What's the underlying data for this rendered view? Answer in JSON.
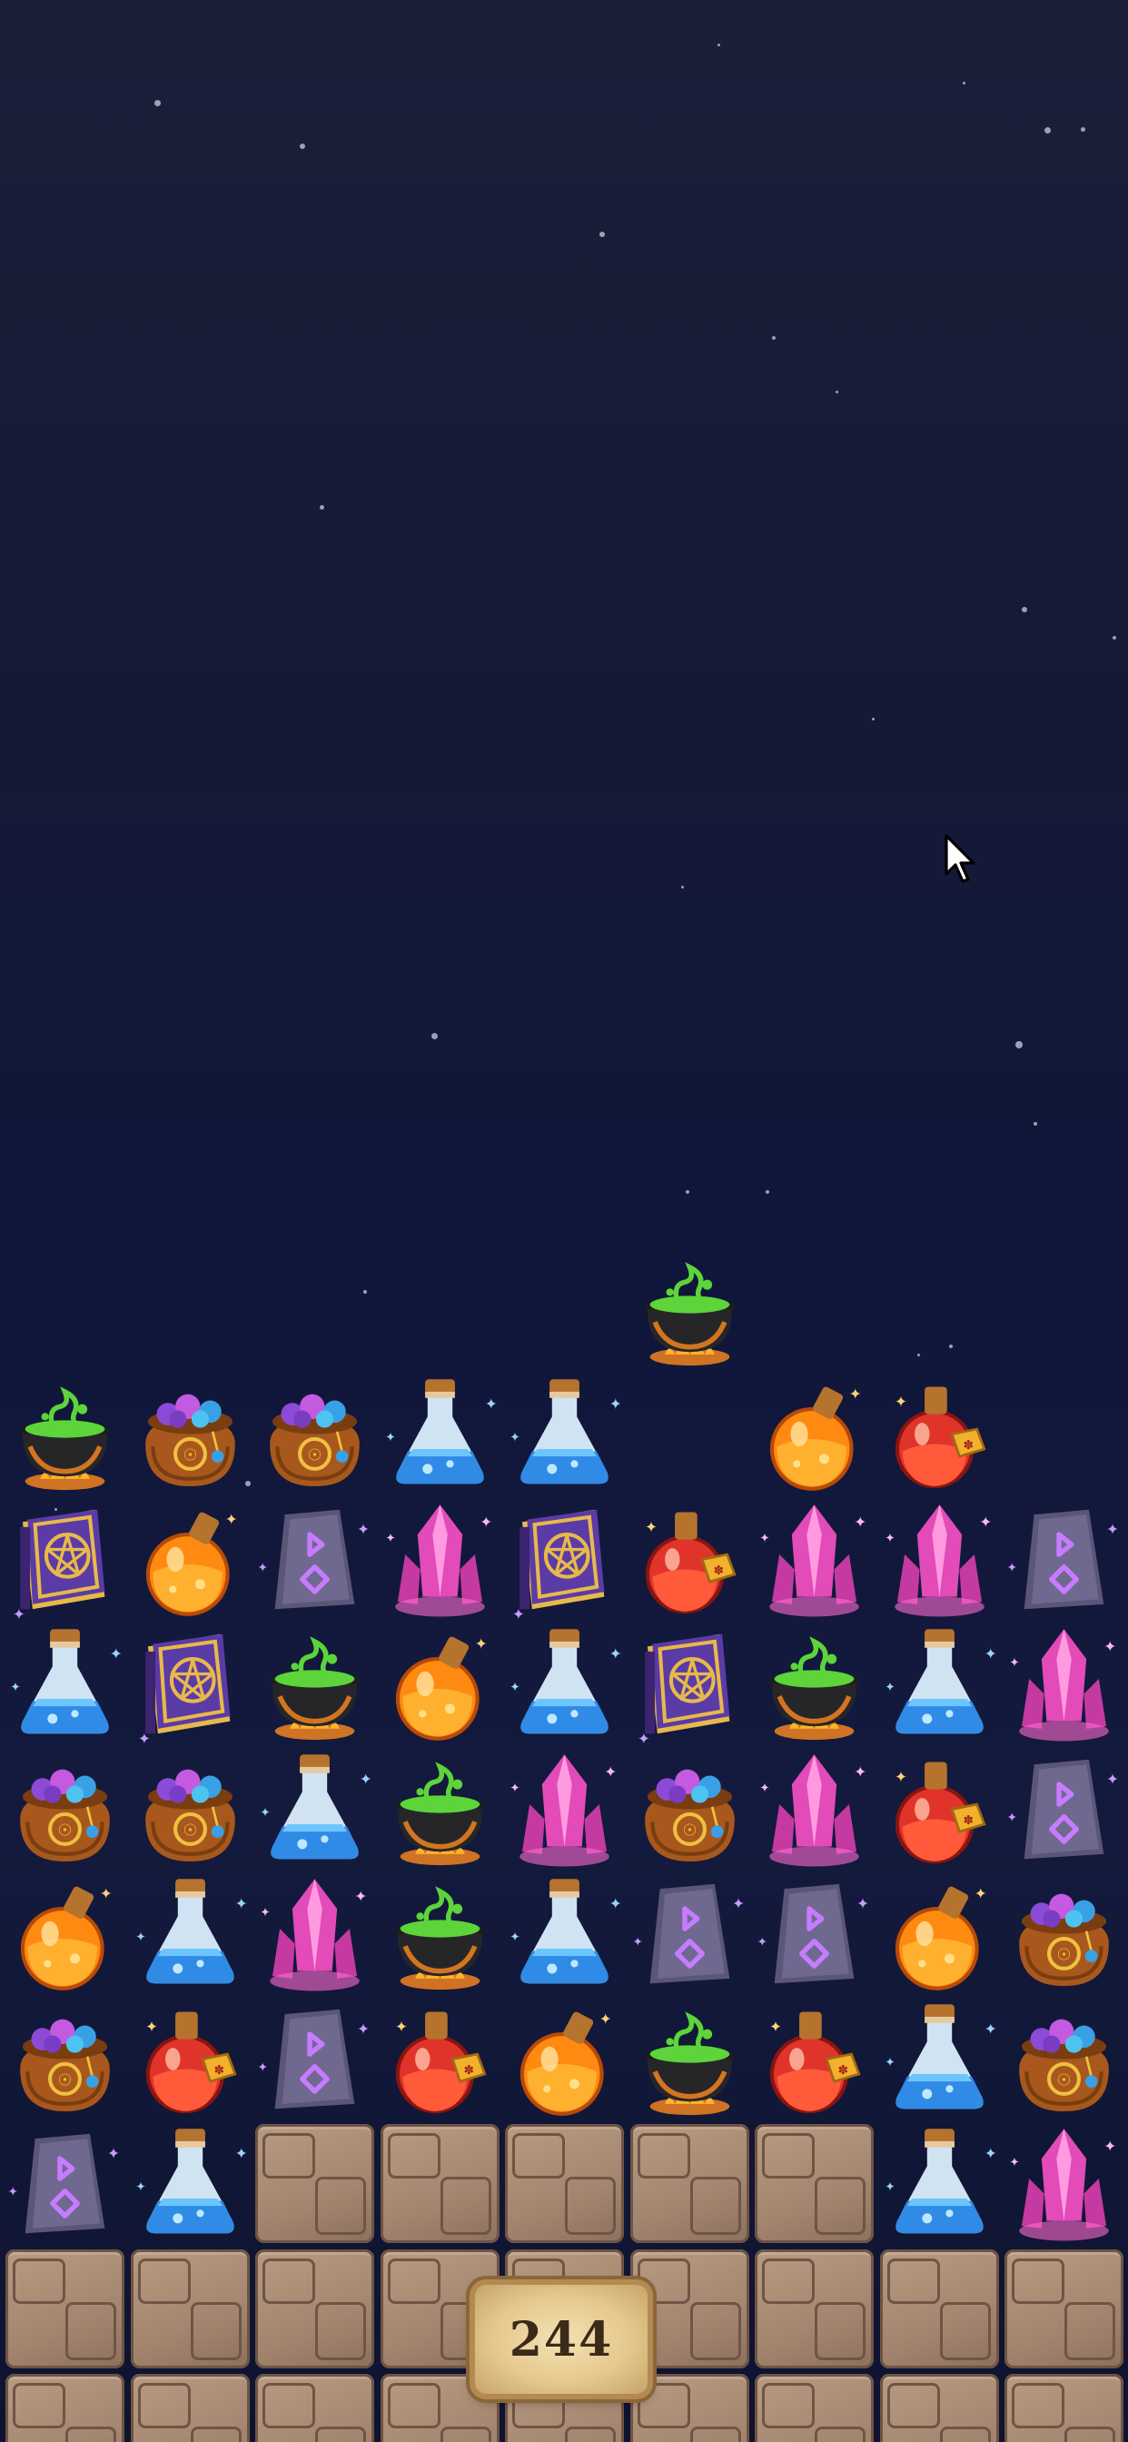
{
  "hud": {
    "moves_remaining": "244"
  },
  "board": {
    "falling_piece": {
      "row": -1,
      "col": 5,
      "type": "cauldron"
    },
    "grid": [
      [
        "cauldron",
        "treasure-bag",
        "treasure-bag",
        "blue-potion",
        "blue-potion",
        null,
        "orange-potion",
        "red-potion",
        null
      ],
      [
        "spellbook",
        "orange-potion",
        "rune-stone",
        "crystal",
        "spellbook",
        "red-potion",
        "crystal",
        "crystal",
        "rune-stone"
      ],
      [
        "blue-potion",
        "spellbook",
        "cauldron",
        "orange-potion",
        "blue-potion",
        "spellbook",
        "cauldron",
        "blue-potion",
        "crystal"
      ],
      [
        "treasure-bag",
        "treasure-bag",
        "blue-potion",
        "cauldron",
        "crystal",
        "treasure-bag",
        "crystal",
        "red-potion",
        "rune-stone"
      ],
      [
        "orange-potion",
        "blue-potion",
        "crystal",
        "cauldron",
        "blue-potion",
        "rune-stone",
        "rune-stone",
        "orange-potion",
        "treasure-bag"
      ],
      [
        "treasure-bag",
        "red-potion",
        "rune-stone",
        "red-potion",
        "orange-potion",
        "cauldron",
        "red-potion",
        "blue-potion",
        "treasure-bag"
      ],
      [
        "rune-stone",
        "blue-potion",
        "stone",
        "stone",
        "stone",
        "stone",
        "stone",
        "blue-potion",
        "crystal"
      ],
      [
        "stone",
        "stone",
        "stone",
        "stone",
        "stone",
        "stone",
        "stone",
        "stone",
        "stone"
      ],
      [
        "stone",
        "stone",
        "stone",
        "stone",
        "stone",
        "stone",
        "stone",
        "stone",
        "stone"
      ]
    ]
  },
  "colors": {
    "sky_top": "#1a2038",
    "sky_bottom": "#0e1330",
    "stone": "#a48670",
    "plaque": "#e5c98e"
  }
}
